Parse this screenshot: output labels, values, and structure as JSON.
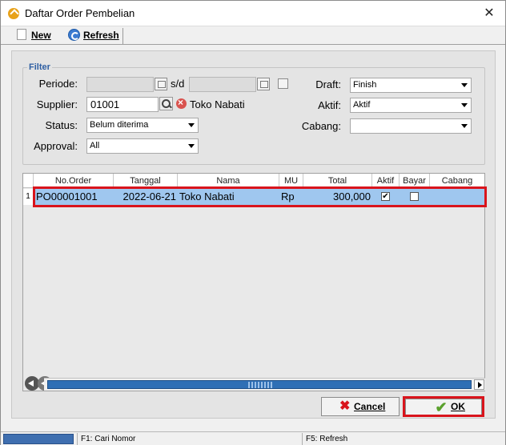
{
  "window": {
    "title": "Daftar Order Pembelian",
    "close_glyph": "✕"
  },
  "toolbar": {
    "new_label": "New",
    "refresh_label": "Refresh"
  },
  "filter": {
    "legend": "Filter",
    "periode_label": "Periode:",
    "sd_label": "s/d",
    "supplier_label": "Supplier:",
    "supplier_code": "01001",
    "supplier_name": "Toko Nabati",
    "status_label": "Status:",
    "status_value": "Belum diterima",
    "approval_label": "Approval:",
    "approval_value": "All",
    "draft_label": "Draft:",
    "draft_value": "Finish",
    "aktif_label": "Aktif:",
    "aktif_value": "Aktif",
    "cabang_label": "Cabang:",
    "cabang_value": ""
  },
  "grid": {
    "columns": [
      "No.Order",
      "Tanggal",
      "Nama",
      "MU",
      "Total",
      "Aktif",
      "Bayar",
      "Cabang"
    ],
    "rows": [
      {
        "num": "1",
        "no_order": "PO00001001",
        "tanggal": "2022-06-21",
        "nama": "Toko Nabati",
        "mu": "Rp",
        "total": "300,000",
        "aktif_checked": "✔",
        "bayar_checked": "",
        "cabang": ""
      }
    ]
  },
  "buttons": {
    "cancel_label": "Cancel",
    "ok_label": "OK"
  },
  "statusbar": {
    "f1": "F1: Cari Nomor",
    "f5": "F5: Refresh"
  },
  "colors": {
    "highlight": "#d9141c",
    "selected_row": "#9fc7ef",
    "accent": "#2f6fb5"
  }
}
